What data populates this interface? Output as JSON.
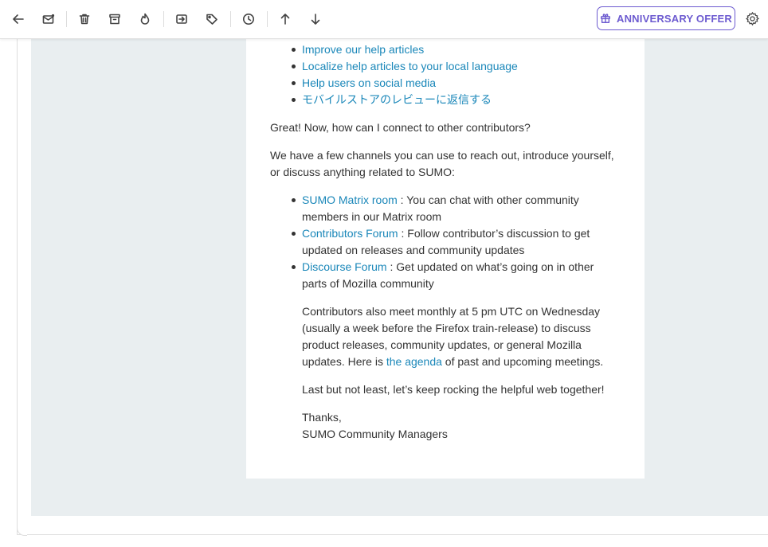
{
  "toolbar": {
    "icons": [
      "back-arrow-icon",
      "mark-unread-icon",
      "trash-icon",
      "archive-icon",
      "spam-icon",
      "move-icon",
      "label-icon",
      "snooze-icon",
      "arrow-up-icon",
      "arrow-down-icon",
      "gift-icon",
      "gear-icon"
    ],
    "offer_label": "ANNIVERSARY OFFER",
    "accent": "#6d5bd0"
  },
  "email": {
    "top_links": [
      "Improve our help articles",
      "Localize help articles to your local language",
      "Help users on social media",
      "モバイルストアのレビューに返信する"
    ],
    "question": "Great! Now, how can I connect to other contributors?",
    "intro": "We have a few channels you can use to reach out, introduce yourself, or discuss anything related to SUMO:",
    "channels": [
      {
        "link": "SUMO Matrix room",
        "text": " : You can chat with other community members in our Matrix room"
      },
      {
        "link": "Contributors Forum",
        "text": " : Follow contributor’s discussion to get updated on releases and community updates"
      },
      {
        "link": "Discourse Forum",
        "text": " : Get updated on what’s going on in other parts of Mozilla community"
      }
    ],
    "meeting_before": "Contributors also meet monthly at 5 pm UTC on Wednesday (usually a week before the Firefox train-release) to discuss product releases, community updates, or general Mozilla updates. Here is ",
    "meeting_link": "the agenda",
    "meeting_after": " of past and upcoming meetings.",
    "closing": "Last but not least, let’s keep rocking the helpful web together!",
    "thanks": "Thanks,",
    "signature": "SUMO Community Managers",
    "link_color": "#1a87b9",
    "background": "#e9eef0"
  }
}
